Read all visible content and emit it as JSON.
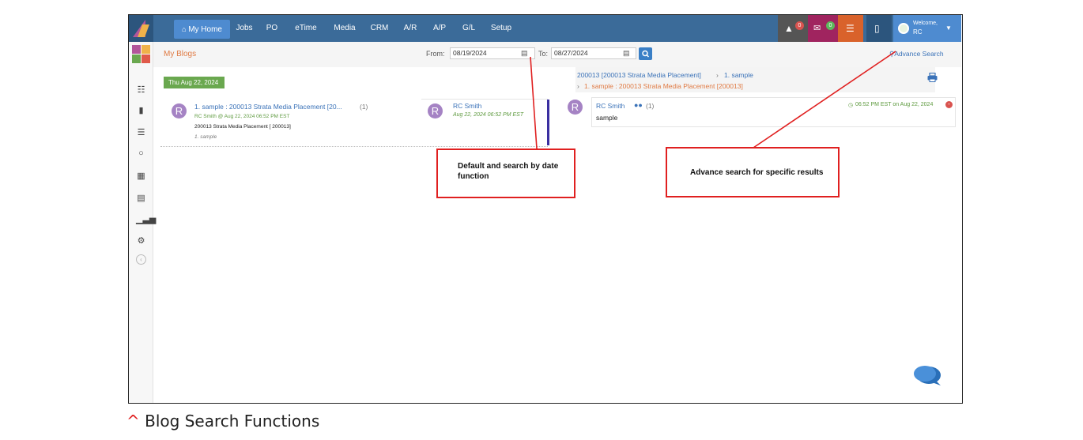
{
  "nav": {
    "items": [
      "My Home",
      "Jobs",
      "PO",
      "eTime",
      "Media",
      "CRM",
      "A/R",
      "A/P",
      "G/L",
      "Setup"
    ],
    "active": "My Home",
    "notifications_count": "0",
    "messages_count": "0",
    "welcome_label": "Welcome,",
    "user_name": "RC"
  },
  "toolbar": {
    "title": "My Blogs",
    "from_label": "From:",
    "from_value": "08/19/2024",
    "to_label": "To:",
    "to_value": "08/27/2024",
    "advance_search": "Advance Search"
  },
  "blog_list": {
    "date_group": "Thu Aug 22, 2024",
    "items": [
      {
        "avatar": "R",
        "title": "1. sample : 200013 Strata Media Placement [20...",
        "count": "(1)",
        "meta": "RC Smith @ Aug 22, 2024 06:52 PM EST",
        "project": "200013 Strata Media Placement [ 200013]",
        "excerpt": "1. sample"
      }
    ],
    "author": {
      "avatar": "R",
      "name": "RC Smith",
      "timestamp": "Aug 22, 2024 06:52 PM EST"
    }
  },
  "detail": {
    "breadcrumb_1": "200013 [200013 Strata Media Placement]",
    "breadcrumb_sep": "›",
    "breadcrumb_2": "1. sample",
    "breadcrumb_3": "1. sample : 200013 Strata Media Placement [200013]",
    "post": {
      "avatar": "R",
      "author": "RC Smith",
      "count": "(1)",
      "time": "06:52 PM EST on Aug 22, 2024",
      "body": "sample"
    }
  },
  "annotations": {
    "date_callout": "Default and search by date function",
    "advance_callout": "Advance search for specific results"
  },
  "caption": {
    "caret": "^",
    "text": "Blog Search Functions"
  },
  "colors": {
    "nav_bg": "#3b6b99",
    "active_tab": "#4e8bd0",
    "callout_border": "#e02020",
    "date_pill": "#6aa84f",
    "avatar": "#a583c4"
  }
}
